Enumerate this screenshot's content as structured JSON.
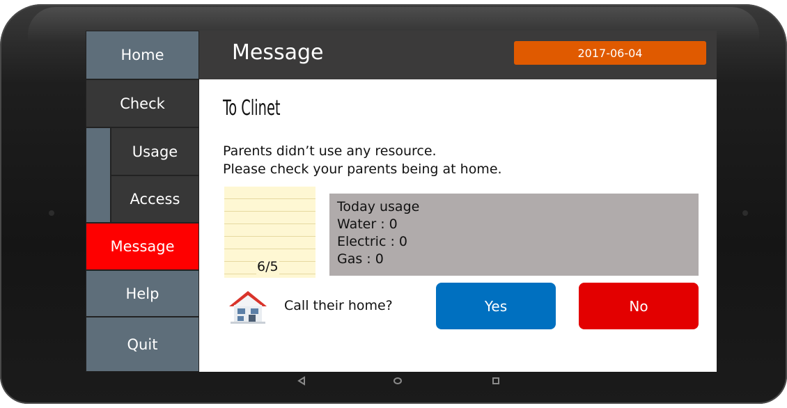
{
  "sidebar": {
    "items": [
      {
        "id": "home",
        "label": "Home"
      },
      {
        "id": "check",
        "label": "Check"
      },
      {
        "id": "usage",
        "label": "Usage"
      },
      {
        "id": "access",
        "label": "Access"
      },
      {
        "id": "message",
        "label": "Message"
      },
      {
        "id": "help",
        "label": "Help"
      },
      {
        "id": "quit",
        "label": "Quit"
      }
    ],
    "active": "message"
  },
  "header": {
    "title": "Message",
    "date": "2017-06-04"
  },
  "message": {
    "to": "To Clinet",
    "lines": [
      "Parents didn’t use any resource.",
      "Please check your parents being at home."
    ]
  },
  "note": {
    "count": "6/5"
  },
  "usage": {
    "title": "Today usage",
    "water": "Water : 0",
    "electric": "Electric : 0",
    "gas": "Gas : 0"
  },
  "call": {
    "icon": "house-icon",
    "prompt": "Call their home?",
    "yes_label": "Yes",
    "no_label": "No"
  },
  "colors": {
    "sidebar_gray": "#5e6e7a",
    "sidebar_dark": "#373737",
    "active_red": "#fe0000",
    "header_bg": "#3b3a3a",
    "date_badge": "#e05a00",
    "yes_blue": "#0070c0",
    "no_red": "#e30000",
    "usage_box": "#b0abab",
    "note_bg": "#fef7d3"
  }
}
